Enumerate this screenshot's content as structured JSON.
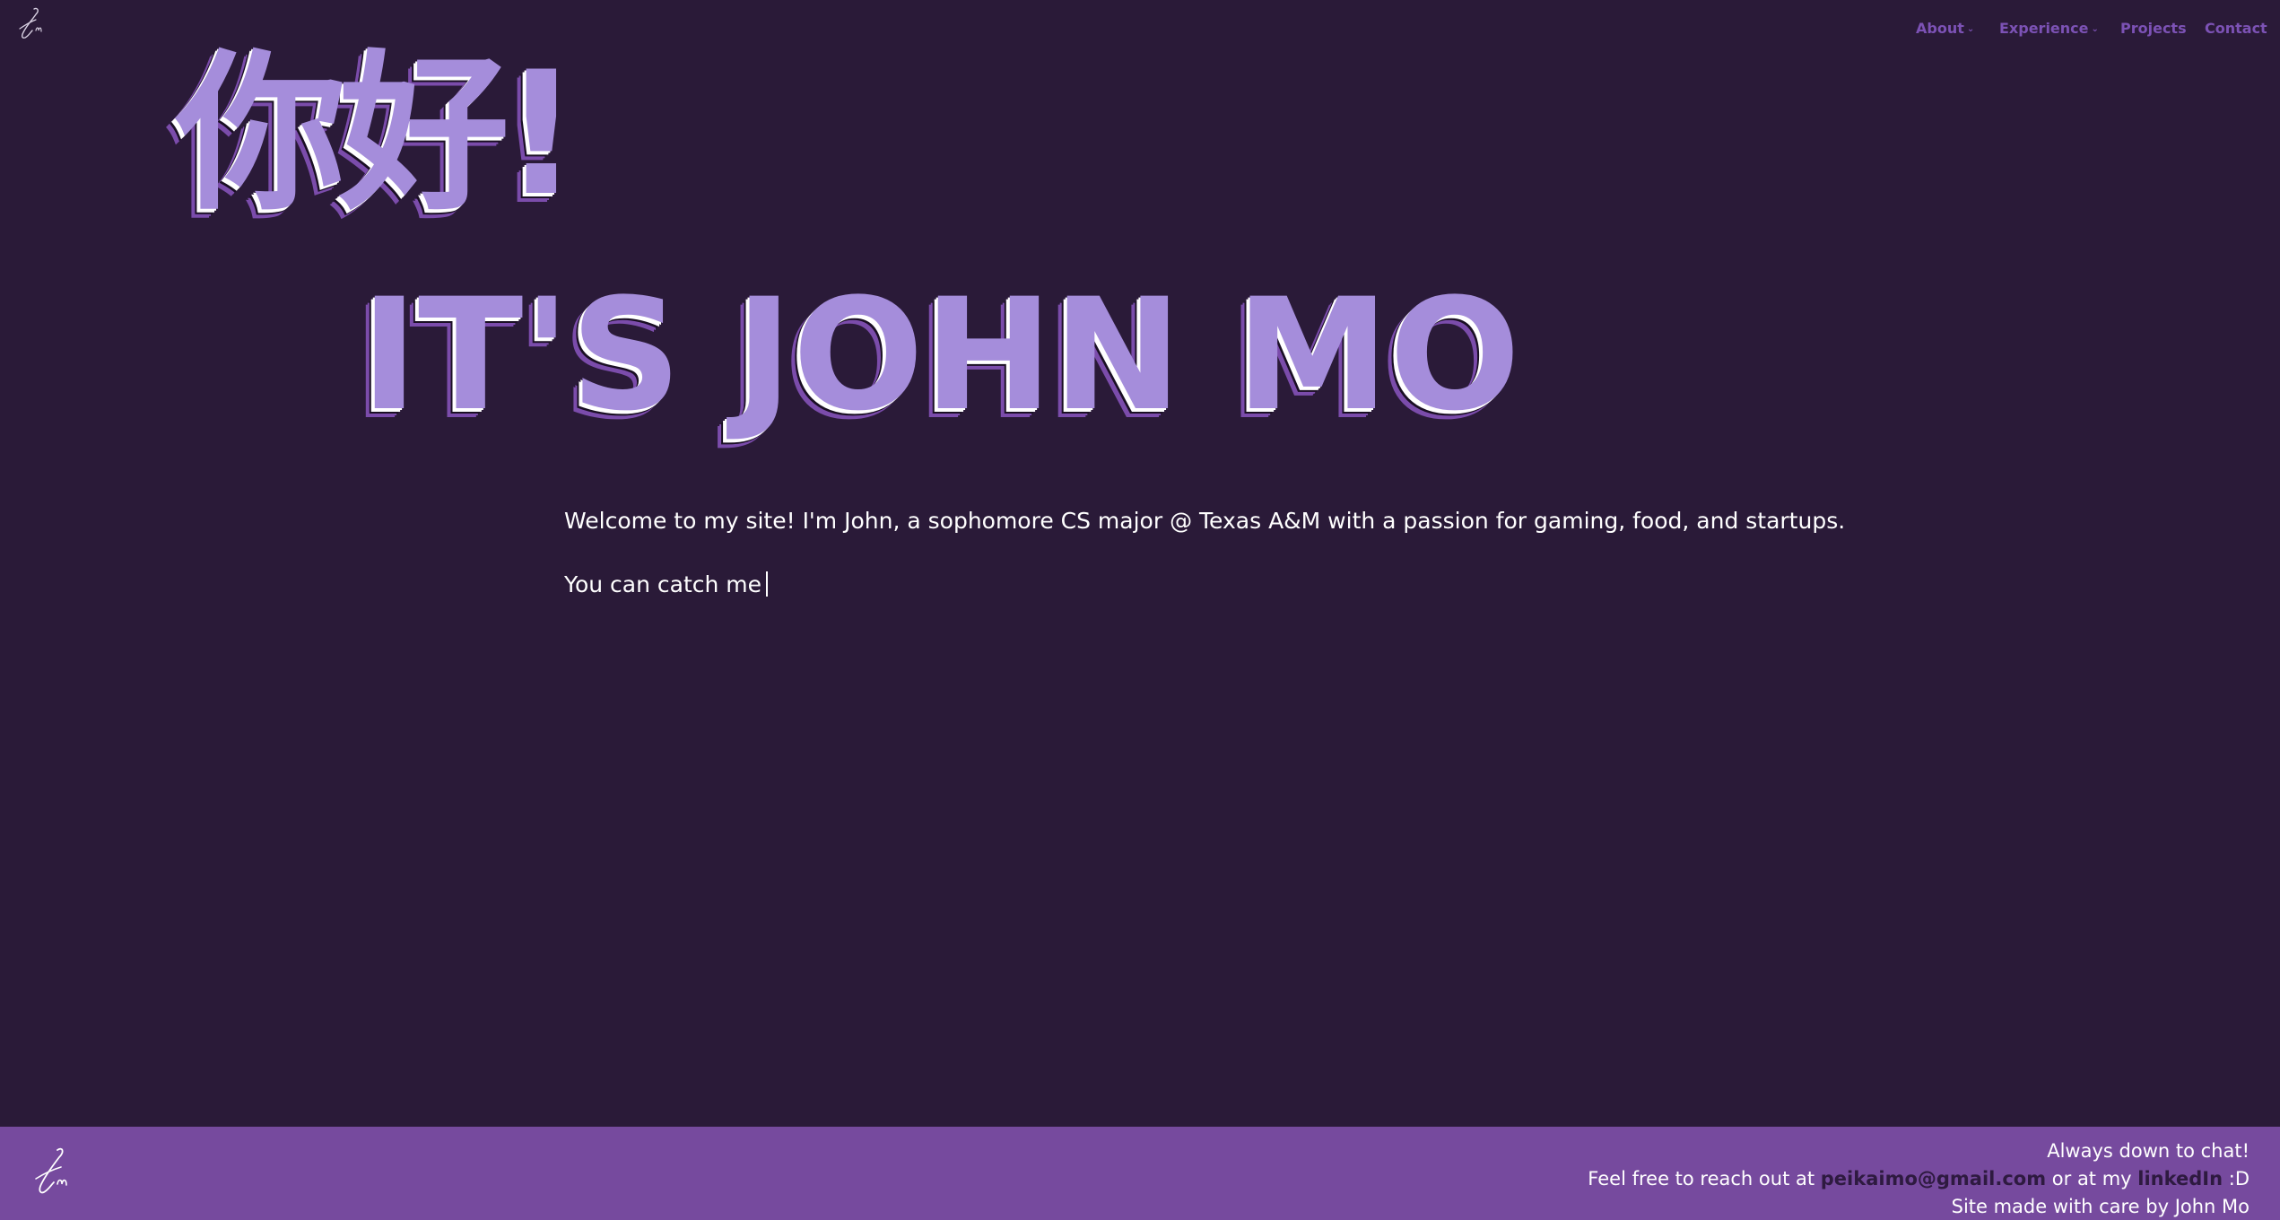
{
  "nav": {
    "items": [
      {
        "label": "About",
        "has_dropdown": true
      },
      {
        "label": "Experience",
        "has_dropdown": true
      },
      {
        "label": "Projects",
        "has_dropdown": false
      },
      {
        "label": "Contact",
        "has_dropdown": false
      }
    ],
    "dropdown_glyph": "⌄"
  },
  "hero": {
    "greeting": "你好!",
    "name_line": "IT'S JOHN MO",
    "intro": "Welcome to my site! I'm John, a sophomore CS major @ Texas A&M with a passion for gaming, food, and startups.",
    "catch_line": "You can catch me"
  },
  "footer": {
    "line1": "Always down to chat!",
    "line2_prefix": "Feel free to reach out at ",
    "email": "peikaimo@gmail.com",
    "line2_mid": " or at my ",
    "linkedin": "linkedIn",
    "line2_suffix": " :D",
    "line3": "Site made with care by John Mo"
  },
  "colors": {
    "background": "#2a1a38",
    "accent": "#a58ddb",
    "nav": "#7c52b5",
    "footer_bg": "#764a9e"
  },
  "icons": {
    "logo": "jm-signature-logo"
  }
}
